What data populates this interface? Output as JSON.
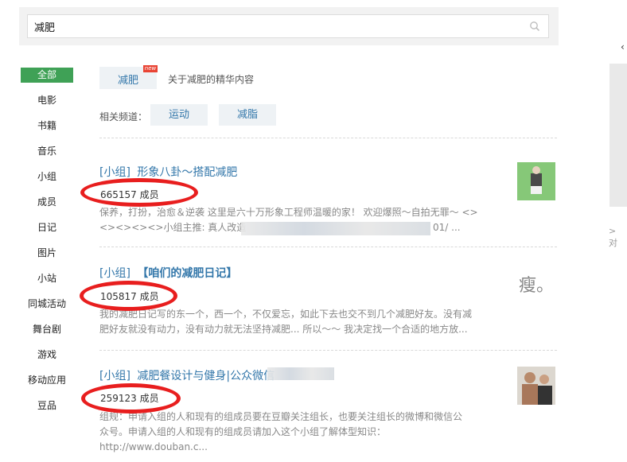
{
  "search": {
    "value": "减肥"
  },
  "nav": {
    "items": [
      "全部",
      "电影",
      "书籍",
      "音乐",
      "小组",
      "成员",
      "日记",
      "图片",
      "小站",
      "同城活动",
      "舞台剧",
      "游戏",
      "移动应用",
      "豆品"
    ]
  },
  "keyword": {
    "tag": "减肥",
    "badge": "new",
    "description": "关于减肥的精华内容"
  },
  "channels": {
    "label": "相关频道：",
    "items": [
      "运动",
      "减脂"
    ]
  },
  "results": [
    {
      "prefix": "[小组]",
      "name": "形象八卦～搭配减肥",
      "members": "665157 成员",
      "desc1": "保养，打扮，治愈＆逆袭 这里是六十万形象工程师温暖的家！ 欢迎爆照～自拍无罪～ <>",
      "desc2a": "<><><><>小组主推: 真人改造",
      "desc2b": "01/ ..."
    },
    {
      "prefix": "[小组]",
      "name": "【咱们的减肥日记】",
      "members": "105817 成员",
      "desc1": "我的减肥日记写的东一个，西一个，不仅爱忘，如此下去也交不到几个减肥好友。没有减",
      "desc2": "肥好友就没有动力，没有动力就无法坚持减肥... 所以～～ 我决定找一个合适的地方放...",
      "thumb_text": "瘦。"
    },
    {
      "prefix": "[小组]",
      "name": "减肥餐设计与健身|公众微信",
      "members": "259123 成员",
      "desc1": "组规：申请入组的人和现有的组成员要在豆瓣关注组长，也要关注组长的微博和微信公",
      "desc2": "众号。申请入组的人和现有的组成员请加入这个小组了解体型知识：",
      "desc3": "http://www.douban.c..."
    }
  ],
  "right_panel": {
    "arrow": "‹",
    "text": "> 对"
  },
  "colors": {
    "accent_green": "#3fa156",
    "link_blue": "#3377aa",
    "annotation_red": "#e81e1e"
  }
}
